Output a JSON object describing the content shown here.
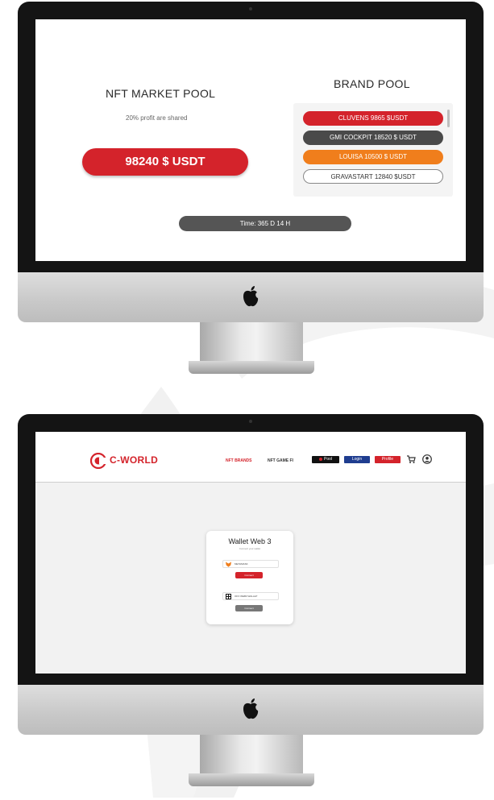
{
  "screen1": {
    "nft_pool": {
      "title": "NFT MARKET POOL",
      "note": "20% profit are shared",
      "amount": "98240 $ USDT"
    },
    "brand_pool": {
      "title": "BRAND POOL",
      "items": [
        "CLUVENS 9865 $USDT",
        "GMI COCKPIT 18520 $ USDT",
        "LOUISA 10500 $ USDT",
        "GRAVASTART 12840 $USDT"
      ]
    },
    "timer": "Time: 365 D 14 H"
  },
  "screen2": {
    "brand": "C-WORLD",
    "nav": {
      "nft_brands": "NFT BRANDS",
      "nft_gamefi": "NFT GAME FI",
      "pool": "Pool",
      "login": "Login",
      "profile": "Profile"
    },
    "wallet": {
      "title": "Wallet Web 3",
      "subtitle": "Connect your wallet",
      "options": [
        {
          "label": "METAMASK",
          "button": "Connect"
        },
        {
          "label": "OKX WEB3 WALLET",
          "button": "Connect"
        }
      ]
    }
  },
  "colors": {
    "accent_red": "#d4232b",
    "accent_orange": "#f07e1c",
    "dark_gray": "#4a4a4a",
    "login_blue": "#1f3d8f"
  },
  "icons": [
    "apple-icon",
    "c-world-logo-icon",
    "cart-icon",
    "user-icon",
    "metamask-fox-icon",
    "wallet-qr-icon"
  ]
}
